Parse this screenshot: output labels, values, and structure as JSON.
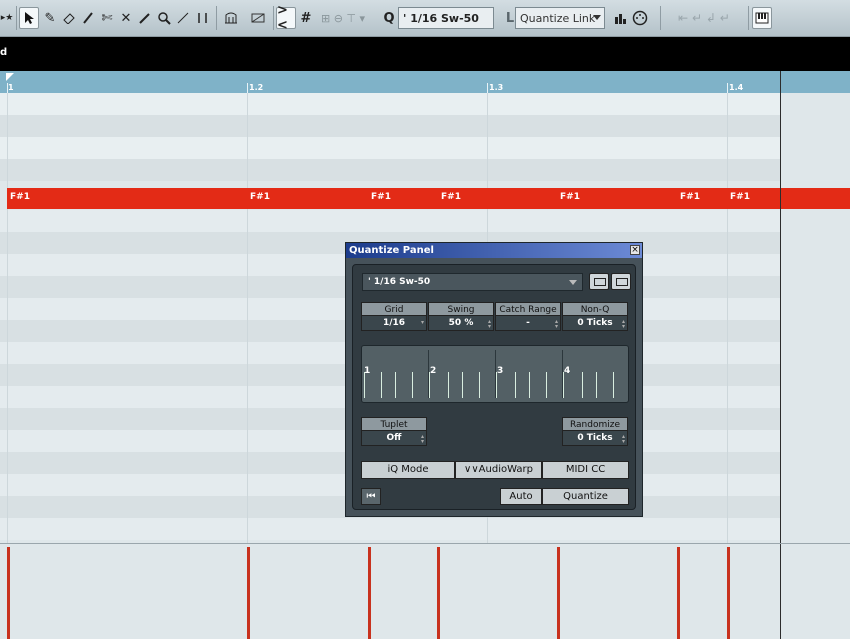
{
  "toolbar": {
    "tools": [
      "select-tool",
      "draw-tool",
      "erase-tool",
      "trim-tool",
      "split-tool",
      "glue-tool",
      "mute-tool",
      "zoom-tool",
      "line-tool",
      "time-warp-tool"
    ],
    "quantize_preset_icon": "Q",
    "quantize_preset": "' 1/16  Sw-50",
    "length_icon": "L",
    "length_quantize": "Quantize Link"
  },
  "track_label": "d",
  "ruler": {
    "markers": [
      "1",
      "1.2",
      "1.3",
      "1.4"
    ]
  },
  "notes": [
    {
      "label": "F#1"
    },
    {
      "label": "F#1"
    },
    {
      "label": "F#1"
    },
    {
      "label": "F#1"
    },
    {
      "label": "F#1"
    },
    {
      "label": "F#1"
    },
    {
      "label": "F#1"
    }
  ],
  "colors": {
    "note": "#e32b16",
    "ruler": "#7fb2c8",
    "velocity": "#c8321e"
  },
  "quantize_panel": {
    "title": "Quantize Panel",
    "preset": "' 1/16  Sw-50",
    "params": [
      {
        "label": "Grid",
        "value": "1/16"
      },
      {
        "label": "Swing",
        "value": "50 %"
      },
      {
        "label": "Catch Range",
        "value": "-"
      },
      {
        "label": "Non-Q",
        "value": "0 Ticks"
      }
    ],
    "grid_numbers": [
      "1",
      "2",
      "3",
      "4"
    ],
    "tuplet": {
      "label": "Tuplet",
      "value": "Off"
    },
    "randomize": {
      "label": "Randomize",
      "value": "0 Ticks"
    },
    "mode_buttons": [
      "iQ  Mode",
      "∨∨AudioWarp",
      "MIDI CC"
    ],
    "auto_label": "Auto",
    "quantize_label": "Quantize",
    "close_symbol": "×"
  }
}
